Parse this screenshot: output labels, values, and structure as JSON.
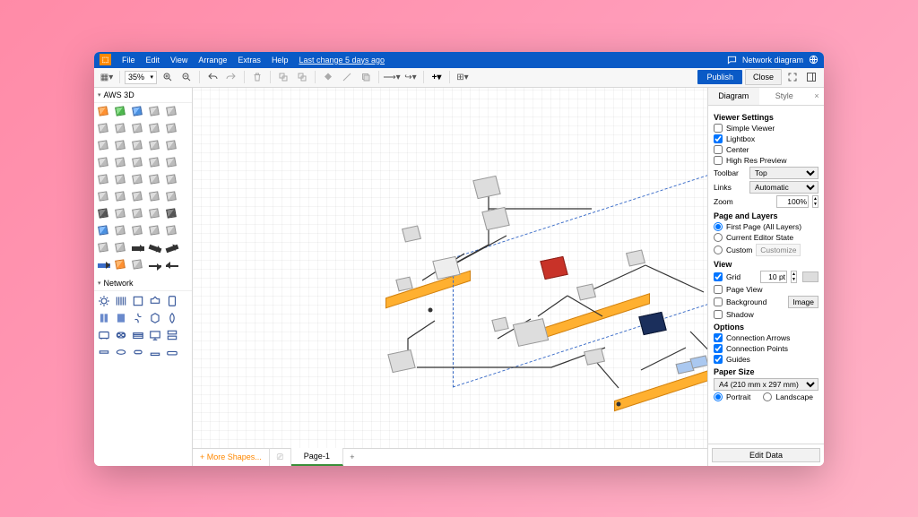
{
  "menubar": {
    "file": "File",
    "edit": "Edit",
    "view": "View",
    "arrange": "Arrange",
    "extras": "Extras",
    "help": "Help",
    "last_change": "Last change 5 days ago",
    "doc_title": "Network diagram"
  },
  "toolbar": {
    "zoom": "35%",
    "publish": "Publish",
    "close": "Close"
  },
  "sidebar": {
    "sect_aws": "AWS 3D",
    "sect_network": "Network",
    "more_shapes": "+ More Shapes..."
  },
  "page_tabs": {
    "page1": "Page-1"
  },
  "rpanel": {
    "tab_diagram": "Diagram",
    "tab_style": "Style",
    "h_viewer": "Viewer Settings",
    "simple_viewer": "Simple Viewer",
    "lightbox": "Lightbox",
    "center": "Center",
    "high_res": "High Res Preview",
    "lbl_toolbar": "Toolbar",
    "toolbar_val": "Top",
    "lbl_links": "Links",
    "links_val": "Automatic",
    "lbl_zoom": "Zoom",
    "zoom_val": "100%",
    "h_page": "Page and Layers",
    "first_page": "First Page (All Layers)",
    "cur_editor": "Current Editor State",
    "custom": "Custom",
    "customize": "Customize",
    "h_view": "View",
    "grid": "Grid",
    "grid_val": "10 pt",
    "page_view": "Page View",
    "background": "Background",
    "image": "Image",
    "shadow": "Shadow",
    "h_options": "Options",
    "conn_arrows": "Connection Arrows",
    "conn_points": "Connection Points",
    "guides": "Guides",
    "h_paper": "Paper Size",
    "paper_val": "A4 (210 mm x 297 mm)",
    "portrait": "Portrait",
    "landscape": "Landscape",
    "edit_data": "Edit Data"
  }
}
